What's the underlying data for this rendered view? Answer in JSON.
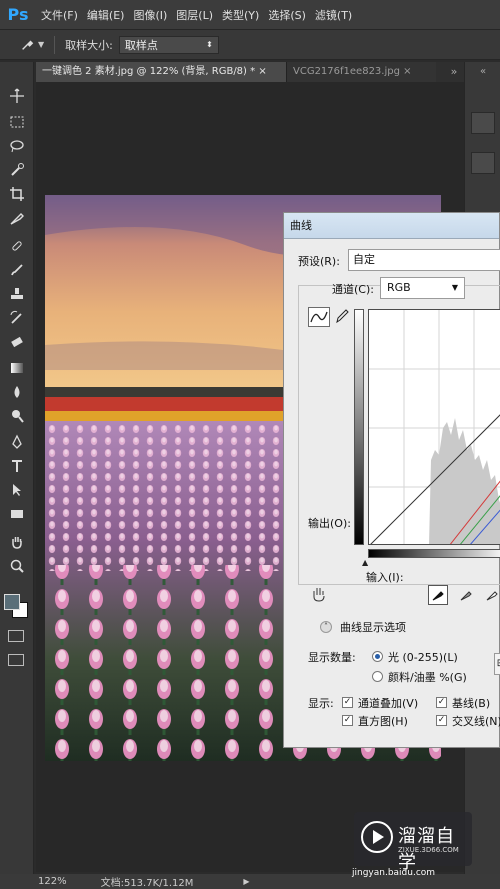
{
  "app": {
    "logo": "Ps"
  },
  "menu": [
    "文件(F)",
    "编辑(E)",
    "图像(I)",
    "图层(L)",
    "类型(Y)",
    "选择(S)",
    "滤镜(T)"
  ],
  "options_bar": {
    "sample_size_label": "取样大小:",
    "sample_size_value": "取样点"
  },
  "tabs": [
    {
      "label": "一键调色 2 素材.jpg @ 122% (背景, RGB/8) *",
      "close": "×",
      "active": true
    },
    {
      "label": "VCG2176f1ee823.jpg",
      "close": "×",
      "active": false
    }
  ],
  "status": {
    "zoom": "122%",
    "doc": "文档:513.7K/1.12M",
    "arrow": "▶"
  },
  "curves": {
    "title": "曲线",
    "preset_label": "预设(R):",
    "preset_value": "自定",
    "channel_label": "通道(C):",
    "channel_value": "RGB",
    "output_label": "输出(O):",
    "input_label": "输入(I):",
    "display_options": "曲线显示选项",
    "show_amount_label": "显示数量:",
    "light_option": "光 (0-255)(L)",
    "pigment_option": "颜料/油墨 %(G)",
    "show_label": "显示:",
    "channel_overlay": "通道叠加(V)",
    "baseline": "基线(B)",
    "histogram": "直方图(H)",
    "intersection": "交叉线(N)"
  },
  "watermark": {
    "brand": "溜溜自学",
    "sub": "ZIXUE.3D66.COM",
    "url": "jingyan.baidu.com"
  },
  "colors": {
    "accent": "#31a8ff",
    "dialog_bg": "#ececec",
    "workspace": "#282828"
  },
  "icons": {
    "toolbar": [
      "move-icon",
      "marquee-icon",
      "lasso-icon",
      "quick-select-icon",
      "crop-icon",
      "eyedropper-icon",
      "healing-brush-icon",
      "brush-icon",
      "stamp-icon",
      "history-brush-icon",
      "eraser-icon",
      "gradient-icon",
      "blur-icon",
      "dodge-icon",
      "pen-icon",
      "type-icon",
      "path-select-icon",
      "rectangle-icon",
      "hand-icon",
      "zoom-icon"
    ]
  }
}
